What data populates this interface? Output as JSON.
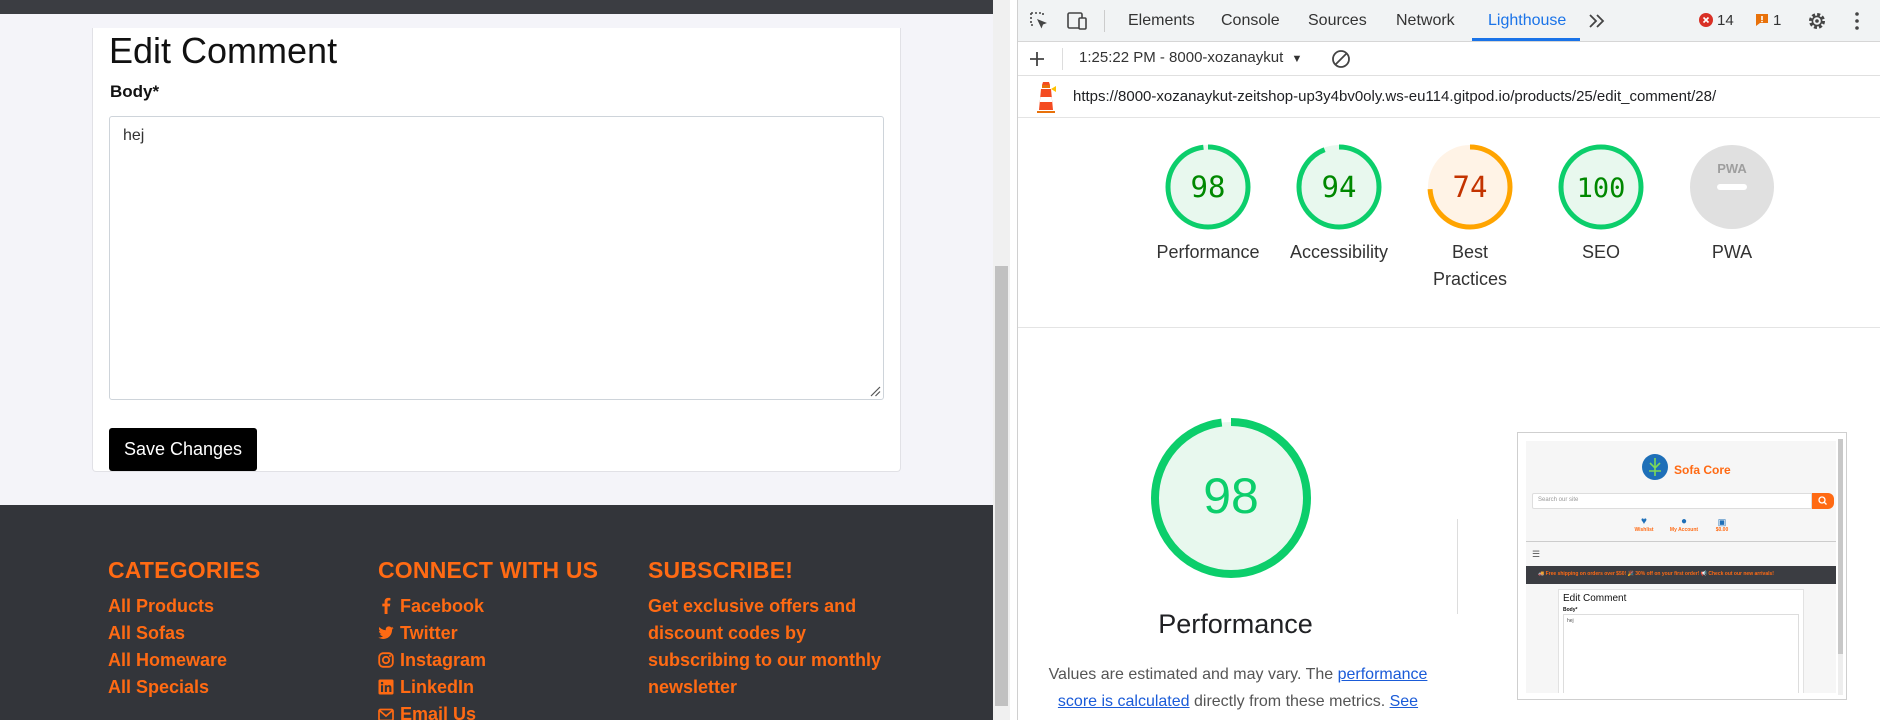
{
  "edit_form": {
    "title": "Edit Comment",
    "body_label": "Body*",
    "body_value": "hej",
    "save_label": "Save Changes"
  },
  "footer": {
    "categories": {
      "heading": "CATEGORIES",
      "links": [
        "All Products",
        "All Sofas",
        "All Homeware",
        "All Specials"
      ]
    },
    "connect": {
      "heading": "CONNECT WITH US",
      "links": [
        {
          "label": "Facebook",
          "icon": "facebook-icon"
        },
        {
          "label": "Twitter",
          "icon": "twitter-icon"
        },
        {
          "label": "Instagram",
          "icon": "instagram-icon"
        },
        {
          "label": "LinkedIn",
          "icon": "linkedin-icon"
        },
        {
          "label": "Email Us",
          "icon": "envelope-icon"
        }
      ]
    },
    "subscribe": {
      "heading": "SUBSCRIBE!",
      "text": "Get exclusive offers and discount codes by subscribing to our monthly newsletter"
    }
  },
  "devtools": {
    "tabs": [
      "Elements",
      "Console",
      "Sources",
      "Network",
      "Lighthouse"
    ],
    "active_tab": "Lighthouse",
    "error_count": "14",
    "warning_count": "1",
    "report_select": "1:25:22 PM - 8000-xozanaykut",
    "report_url": "https://8000-xozanaykut-zeitshop-up3y4bv0oly.ws-eu114.gitpod.io/products/25/edit_comment/28/"
  },
  "lighthouse": {
    "scores": [
      {
        "label": "Performance",
        "value": 98,
        "display": "98",
        "status": "pass"
      },
      {
        "label": "Accessibility",
        "value": 94,
        "display": "94",
        "status": "pass"
      },
      {
        "label": "Best Practices",
        "value": 74,
        "display": "74",
        "status": "average"
      },
      {
        "label": "SEO",
        "value": 100,
        "display": "100",
        "status": "pass"
      },
      {
        "label": "PWA",
        "value": null,
        "display": "PWA",
        "status": "na"
      }
    ],
    "detail": {
      "score": "98",
      "value": 98,
      "title": "Performance",
      "note_pre": "Values are estimated and may vary. The ",
      "note_link": "performance score is calculated",
      "note_mid": " directly from these metrics. ",
      "note_link2": "See"
    },
    "colors": {
      "pass": "#0cce6b",
      "pass_text": "#008800",
      "pass_bg": "#e8f8ee",
      "average": "#ffa400",
      "average_text": "#c33300",
      "average_bg": "#fff3e6",
      "na": "#e0e0e0"
    }
  },
  "thumbnail": {
    "brand": "Sofa Core",
    "search_placeholder": "Search our site",
    "icons": [
      "Wishlist",
      "My Account",
      "$0.00"
    ],
    "banner": "🚚 Free shipping on orders over $50!   🎉 30% off on your first order!   📢 Check out our new arrivals!",
    "card_title": "Edit Comment",
    "card_label": "Body*",
    "card_value": "hej"
  }
}
